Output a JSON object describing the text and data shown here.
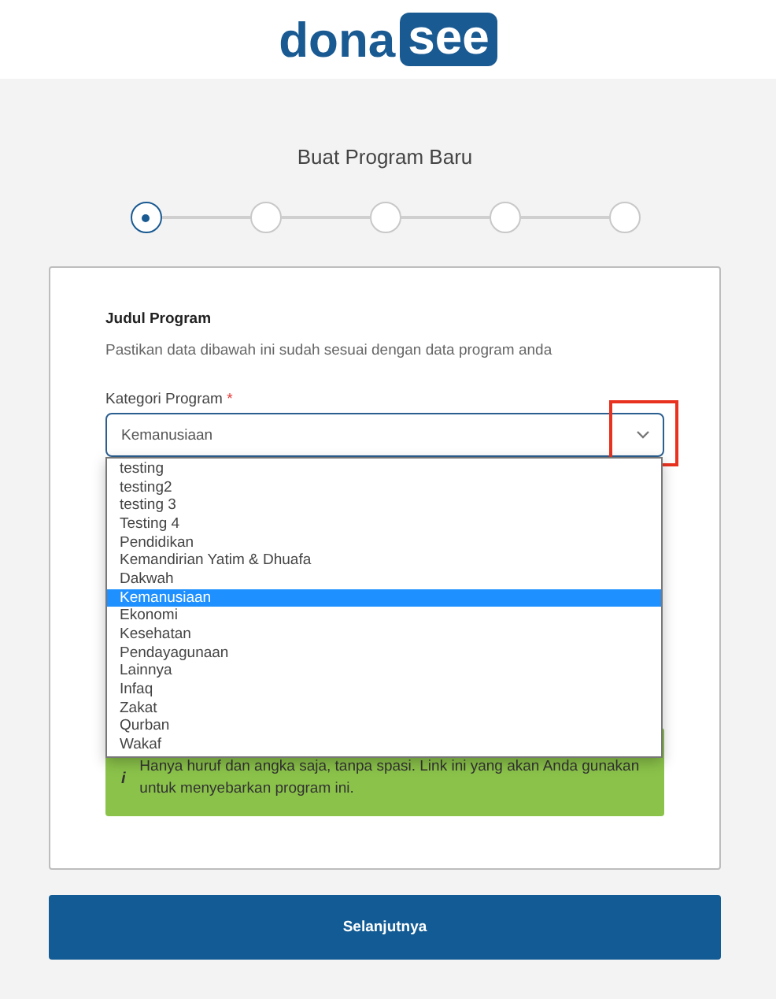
{
  "logo": {
    "part_1": "dona",
    "part_2": "see"
  },
  "page_title": "Buat Program Baru",
  "steps": [
    {
      "selected": true
    },
    {
      "selected": false
    },
    {
      "selected": false
    },
    {
      "selected": false
    },
    {
      "selected": false
    }
  ],
  "form": {
    "heading": "Judul Program",
    "description": "Pastikan data dibawah ini sudah sesuai dengan data program anda",
    "category": {
      "label": "Kategori Program",
      "required_mark": "*",
      "value": "Kemanusiaan",
      "expanded": true,
      "options": [
        {
          "label": "testing",
          "selected": false
        },
        {
          "label": "testing2",
          "selected": false
        },
        {
          "label": "testing 3",
          "selected": false
        },
        {
          "label": "Testing 4",
          "selected": false
        },
        {
          "label": "Pendidikan",
          "selected": false
        },
        {
          "label": "Kemandirian Yatim & Dhuafa",
          "selected": false
        },
        {
          "label": "Dakwah",
          "selected": false
        },
        {
          "label": "Kemanusiaan",
          "selected": true
        },
        {
          "label": "Ekonomi",
          "selected": false
        },
        {
          "label": "Kesehatan",
          "selected": false
        },
        {
          "label": "Pendayagunaan",
          "selected": false
        },
        {
          "label": "Lainnya",
          "selected": false
        },
        {
          "label": "Infaq",
          "selected": false
        },
        {
          "label": "Zakat",
          "selected": false
        },
        {
          "label": "Qurban",
          "selected": false
        },
        {
          "label": "Wakaf",
          "selected": false
        }
      ]
    },
    "note": {
      "icon": "i",
      "text": "Hanya huruf dan angka saja, tanpa spasi. Link ini yang akan Anda gunakan untuk menyebarkan program ini."
    }
  },
  "next_button": "Selanjutnya"
}
